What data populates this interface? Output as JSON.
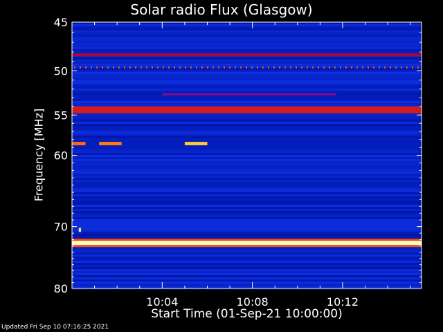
{
  "chart_data": {
    "type": "heatmap",
    "title": "Solar radio Flux (Glasgow)",
    "xlabel": "Start Time (01-Sep-21 10:00:00)",
    "ylabel": "Frequency [MHz]",
    "x_start": "10:00:00",
    "xlim_minutes": [
      0,
      15.5
    ],
    "xticks": [
      {
        "minute": 4,
        "label": "10:04"
      },
      {
        "minute": 8,
        "label": "10:08"
      },
      {
        "minute": 12,
        "label": "10:12"
      }
    ],
    "ylim": [
      45,
      80
    ],
    "yscale": "log",
    "yinverted": true,
    "yticks": [
      45,
      50,
      55,
      60,
      70,
      80
    ],
    "colormap": [
      "#000020",
      "#0010a0",
      "#1a3cff",
      "#7a10a0",
      "#c00020",
      "#ff5010",
      "#ffb000",
      "#ffffc0"
    ],
    "background_color": "#0022c0",
    "features": [
      {
        "name": "persistent band",
        "freq": 48.3,
        "intensity": 0.55
      },
      {
        "name": "dotted line",
        "freq": 49.6,
        "intensity": 0.7
      },
      {
        "name": "faint line",
        "freq": 52.6,
        "t_start": 4.0,
        "t_end": 11.7,
        "intensity": 0.45
      },
      {
        "name": "strong band",
        "freq": 54.4,
        "intensity": 0.62
      },
      {
        "name": "burst",
        "freq": 58.5,
        "t_start": 5.0,
        "t_end": 6.0,
        "intensity": 0.9
      },
      {
        "name": "burst",
        "freq": 58.5,
        "t_start": 1.2,
        "t_end": 2.2,
        "intensity": 0.78
      },
      {
        "name": "burst",
        "freq": 58.5,
        "t_start": 0.0,
        "t_end": 0.6,
        "intensity": 0.75
      },
      {
        "name": "intense band",
        "freq": 72.5,
        "intensity": 1.0
      },
      {
        "name": "spot",
        "freq": 70.5,
        "t_start": 0.3,
        "t_end": 0.4,
        "intensity": 0.95
      }
    ]
  },
  "footer": {
    "updated": "Updated Fri Sep 10 07:16:25 2021"
  }
}
